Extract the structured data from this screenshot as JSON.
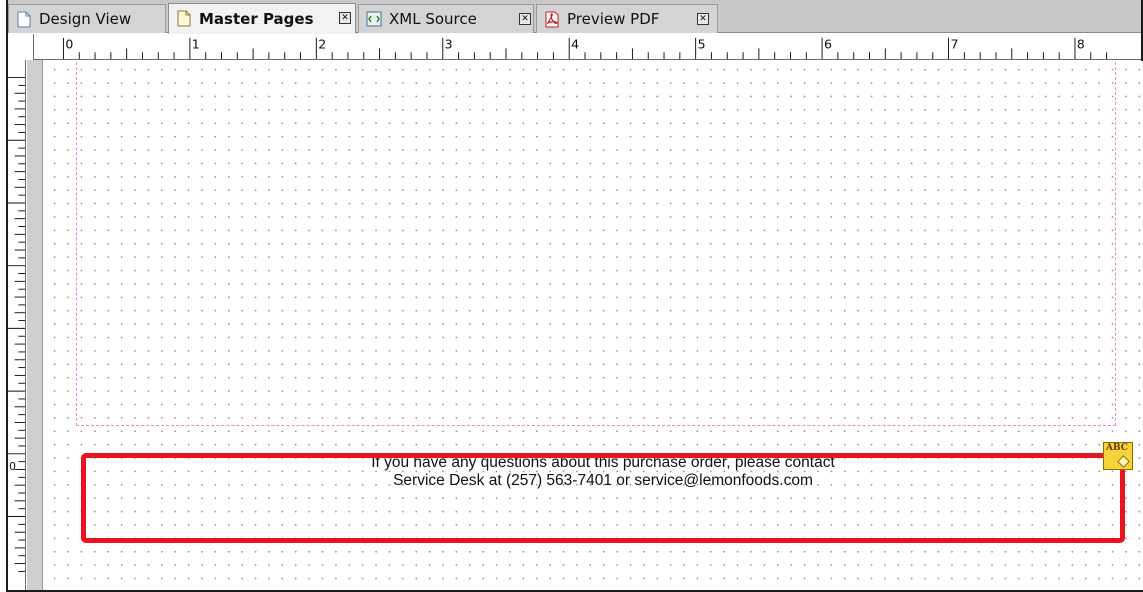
{
  "tabs": [
    {
      "label": "Design View",
      "active": false,
      "closable": false,
      "icon": "page-icon"
    },
    {
      "label": "Master Pages",
      "active": true,
      "closable": true,
      "icon": "page-icon"
    },
    {
      "label": "XML Source",
      "active": false,
      "closable": true,
      "icon": "xml-icon"
    },
    {
      "label": "Preview PDF",
      "active": false,
      "closable": true,
      "icon": "pdf-icon"
    }
  ],
  "close_glyph": "✕",
  "ruler": {
    "labels": [
      "0",
      "1",
      "2",
      "3",
      "4",
      "5",
      "6",
      "7",
      "8"
    ],
    "vertical_label": "0"
  },
  "footer": {
    "line1": "If you have any questions about this purchase order, please contact",
    "line2": "Service Desk at (257) 563-7401 or service@lemonfoods.com"
  },
  "badge": {
    "text": "ABC"
  },
  "colors": {
    "highlight": "#e8141e",
    "margin_guide": "#d98bd9",
    "tab_bar": "#c9c9c9"
  }
}
